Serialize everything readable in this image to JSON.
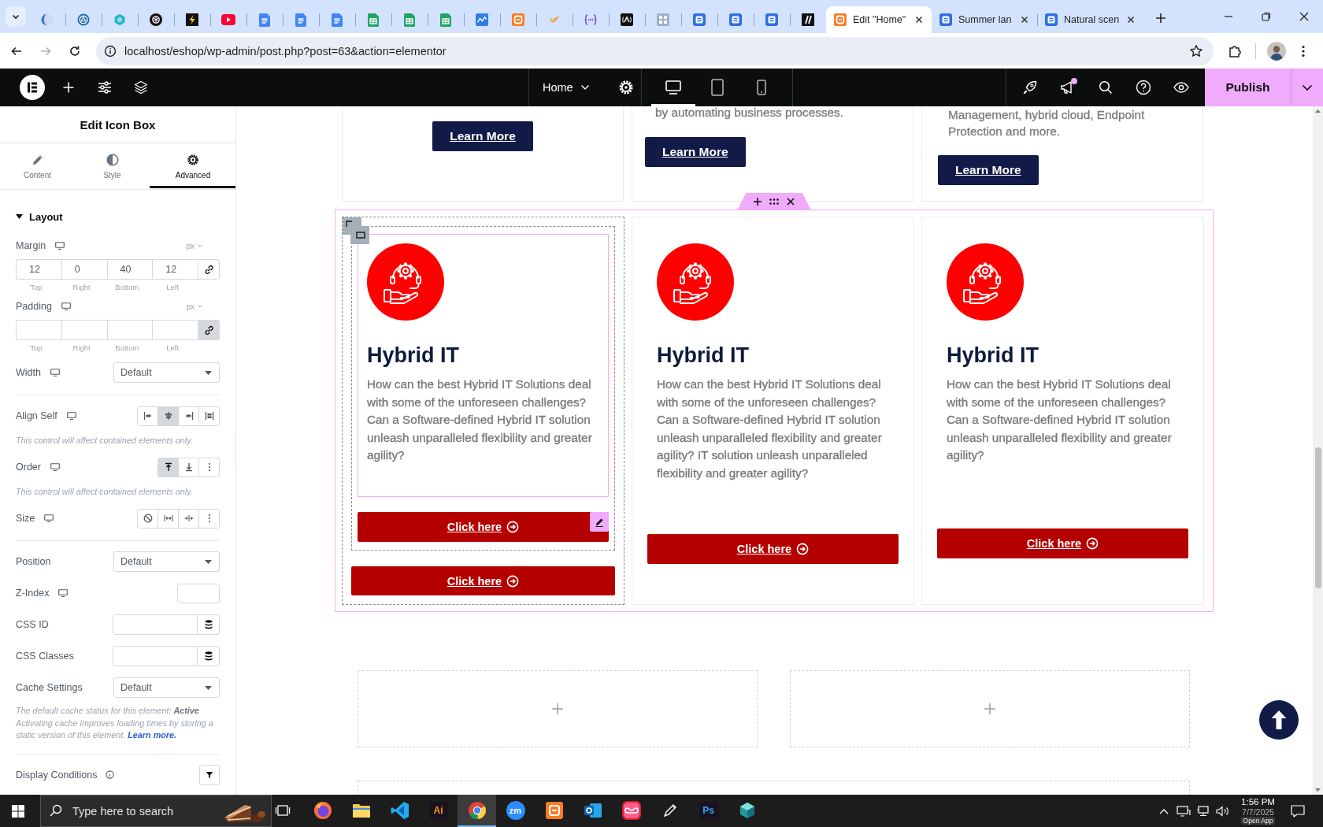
{
  "browser": {
    "tabs": [
      {
        "kind": "sphere",
        "selected": false
      },
      {
        "kind": "ring",
        "selected": false
      },
      {
        "kind": "hexagon",
        "selected": false
      },
      {
        "kind": "knot",
        "selected": false
      },
      {
        "kind": "bolt",
        "selected": false
      },
      {
        "kind": "play",
        "selected": false
      },
      {
        "kind": "doc",
        "selected": false
      },
      {
        "kind": "doc",
        "selected": false
      },
      {
        "kind": "doc",
        "selected": false
      },
      {
        "kind": "sheet",
        "selected": false
      },
      {
        "kind": "sheet",
        "selected": false
      },
      {
        "kind": "sheet",
        "selected": false
      },
      {
        "kind": "wave-tile",
        "selected": false
      },
      {
        "kind": "square-logo",
        "selected": false
      },
      {
        "kind": "bird",
        "selected": false
      },
      {
        "kind": "braces",
        "selected": false
      },
      {
        "kind": "caret-tile",
        "selected": false
      },
      {
        "kind": "grid-tile",
        "selected": false
      },
      {
        "kind": "form",
        "selected": false
      },
      {
        "kind": "form",
        "selected": false
      },
      {
        "kind": "form",
        "selected": false
      },
      {
        "kind": "slash-tile",
        "selected": false
      },
      {
        "kind": "square-logo",
        "title": "Edit \"Home\"",
        "selected": true
      },
      {
        "kind": "form",
        "title": "Summer lan",
        "selected": false
      },
      {
        "kind": "form",
        "title": "Natural scen",
        "selected": false
      }
    ],
    "url": "localhost/eshop/wp-admin/post.php?post=63&action=elementor"
  },
  "editor_bar": {
    "page": "Home",
    "devices": [
      {
        "kind": "desktop",
        "selected": true
      },
      {
        "kind": "tablet",
        "selected": false
      },
      {
        "kind": "mobile",
        "selected": false
      }
    ],
    "whats_new_unread": true,
    "publish": "Publish"
  },
  "panel": {
    "title": "Edit Icon Box",
    "tabs": [
      {
        "kind": "pencil",
        "label": "Content",
        "selected": false
      },
      {
        "kind": "contrast",
        "label": "Style",
        "selected": false
      },
      {
        "kind": "gear",
        "label": "Advanced",
        "selected": true
      }
    ],
    "section": {
      "title": "Layout",
      "expanded": true
    },
    "groups": [
      {
        "controls": [
          {
            "kind": "dimensions",
            "label": "Margin",
            "responsive": true,
            "unit": "px",
            "linked": false,
            "fields": [
              {
                "sublabel": "Top",
                "value": "12"
              },
              {
                "sublabel": "Right",
                "value": "0"
              },
              {
                "sublabel": "Bottom",
                "value": "40"
              },
              {
                "sublabel": "Left",
                "value": "12"
              }
            ]
          },
          {
            "kind": "dimensions",
            "label": "Padding",
            "responsive": true,
            "unit": "px",
            "linked": true,
            "fields": [
              {
                "sublabel": "Top"
              },
              {
                "sublabel": "Right"
              },
              {
                "sublabel": "Bottom"
              },
              {
                "sublabel": "Left"
              }
            ]
          },
          {
            "kind": "select",
            "label": "Width",
            "responsive": true,
            "value": "Default"
          }
        ]
      },
      {
        "controls": [
          {
            "kind": "choices",
            "label": "Align Self",
            "responsive": true,
            "options": [
              {
                "kind": "start",
                "selected": false
              },
              {
                "kind": "center",
                "selected": true
              },
              {
                "kind": "end",
                "selected": false
              },
              {
                "kind": "stretch",
                "selected": false
              }
            ],
            "note": "This control will affect contained elements only."
          },
          {
            "kind": "choices",
            "label": "Order",
            "responsive": true,
            "options": [
              {
                "kind": "first",
                "selected": true
              },
              {
                "kind": "last",
                "selected": false
              },
              {
                "kind": "more",
                "selected": false
              }
            ],
            "note": "This control will affect contained elements only."
          },
          {
            "kind": "choices",
            "label": "Size",
            "responsive": true,
            "options": [
              {
                "kind": "none",
                "selected": false
              },
              {
                "kind": "grow",
                "selected": false
              },
              {
                "kind": "shrink",
                "selected": false
              },
              {
                "kind": "more",
                "selected": false
              }
            ]
          }
        ]
      },
      {
        "controls": [
          {
            "kind": "select",
            "label": "Position",
            "responsive": false,
            "value": "Default"
          },
          {
            "kind": "number",
            "label": "Z-Index",
            "responsive": true
          },
          {
            "kind": "dynamic",
            "label": "CSS ID",
            "responsive": false
          },
          {
            "kind": "dynamic",
            "label": "CSS Classes",
            "responsive": false
          },
          {
            "kind": "select",
            "label": "Cache Settings",
            "responsive": false,
            "value": "Default",
            "note": "The default cache status for this element: **Active**",
            "note_detail": "Activating cache improves loading times by storing a static version of this element.",
            "note_link": "Learn more."
          }
        ]
      },
      {
        "controls": [
          {
            "kind": "conditions",
            "label": "Display Conditions",
            "responsive": false
          }
        ]
      }
    ]
  },
  "canvas": {
    "top_cards": [
      {
        "button": "Learn More"
      },
      {
        "text_lines": [
          "by automating business processes."
        ],
        "button": "Learn More"
      },
      {
        "text_lines": [
          "Management, hybrid cloud, Endpoint",
          "Protection and more."
        ],
        "button": "Learn More"
      }
    ],
    "section": {
      "selected": true,
      "cards": [
        {
          "selected": true,
          "widget_selected": true,
          "title": "Hybrid IT",
          "description": "How can the best Hybrid IT Solutions deal with some of the unforeseen challenges? Can a Software-defined Hybrid IT solution unleash unparalleled flexibility and greater agility?",
          "button": "Click here",
          "extra_button": "Click here"
        },
        {
          "selected": false,
          "widget_selected": false,
          "title": "Hybrid IT",
          "description": "How can the best Hybrid IT Solutions deal with some of the unforeseen challenges? Can a Software-defined Hybrid IT solution unleash unparalleled flexibility and greater agility? IT solution unleash unparalleled flexibility and greater agility?",
          "button": "Click here"
        },
        {
          "selected": false,
          "widget_selected": false,
          "title": "Hybrid IT",
          "description": "How can the best Hybrid IT Solutions deal with some of the unforeseen challenges? Can a Software-defined Hybrid IT solution unleash unparalleled flexibility and greater agility?",
          "button": "Click here"
        }
      ]
    }
  },
  "taskbar": {
    "search_placeholder": "Type here to search",
    "apps": [
      {
        "kind": "task-view",
        "selected": false
      },
      {
        "kind": "fox-globe",
        "selected": false
      },
      {
        "kind": "folder",
        "selected": false
      },
      {
        "kind": "ribbon",
        "selected": false
      },
      {
        "kind": "letter-tile",
        "label": "Ai",
        "color": "#ff9a00",
        "selected": false
      },
      {
        "kind": "color-wheel",
        "selected": true
      },
      {
        "kind": "round-badge",
        "label": "zm",
        "selected": false
      },
      {
        "kind": "square-logo",
        "selected": false
      },
      {
        "kind": "mail",
        "selected": false
      },
      {
        "kind": "cloud-tile",
        "selected": false
      },
      {
        "kind": "pen",
        "selected": false
      },
      {
        "kind": "letter-tile",
        "label": "Ps",
        "color": "#31a8ff",
        "selected": false
      },
      {
        "kind": "cube",
        "selected": false
      }
    ],
    "time": "1:56 PM",
    "date": "7/7/2025",
    "badge": "Open App"
  }
}
